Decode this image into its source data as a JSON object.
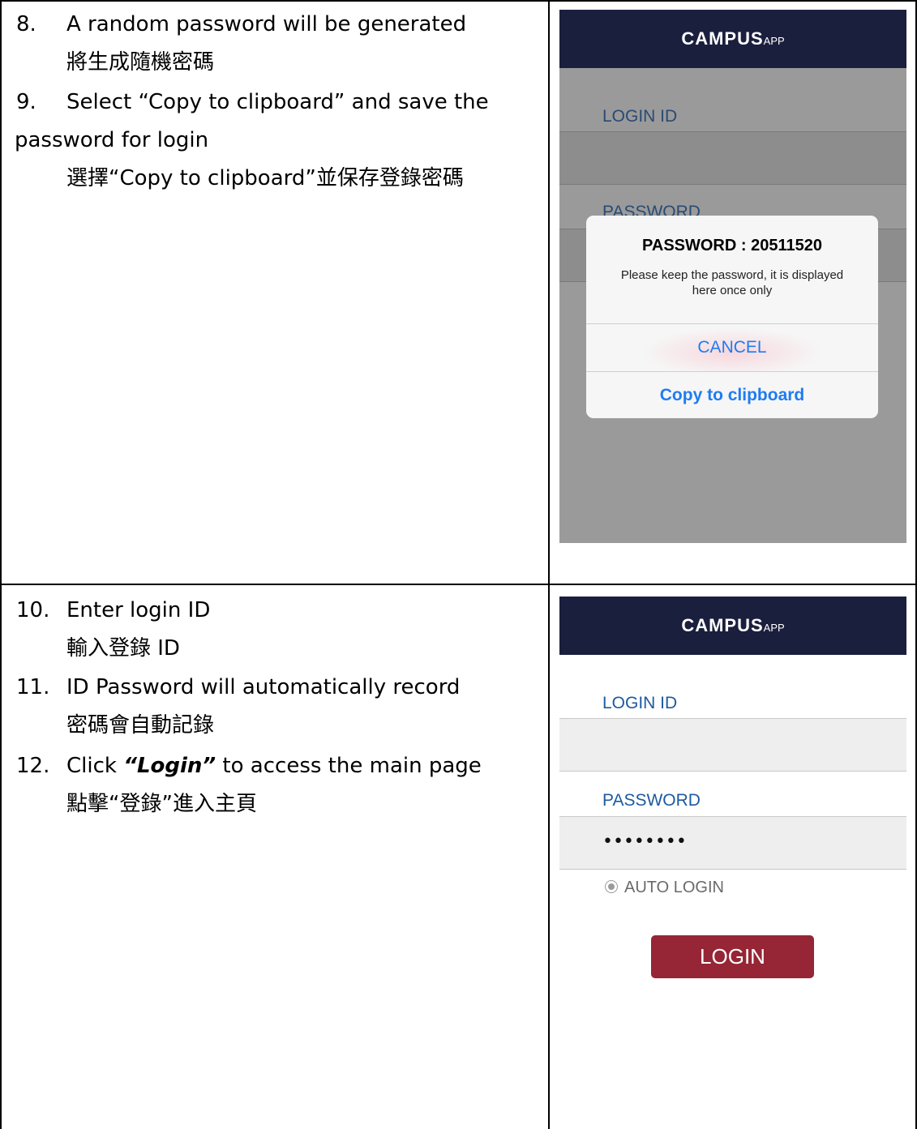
{
  "section1": {
    "steps": [
      {
        "num": "8.",
        "text": "A random password will be generated",
        "cjk": "將生成隨機密碼"
      },
      {
        "num": "9.",
        "text": "Select “Copy to clipboard” and save the",
        "cont": "password for login",
        "cjk": "選擇“Copy to clipboard”並保存登錄密碼"
      }
    ],
    "phone": {
      "brand": "CAMPUS",
      "brand_suffix": "APP",
      "login_id_label": "LOGIN ID",
      "password_label": "PASSWORD",
      "dialog": {
        "title": "PASSWORD : 20511520",
        "message": "Please keep the password, it is displayed here once only",
        "cancel_label": "CANCEL",
        "copy_label": "Copy to clipboard"
      }
    }
  },
  "section2": {
    "steps": [
      {
        "num": "10.",
        "text": "Enter login ID",
        "cjk": "輸入登錄  ID"
      },
      {
        "num": "11.",
        "text": "ID Password will automatically record",
        "cjk": "密碼會自動記錄"
      },
      {
        "num": "12.",
        "text_pre": "Click ",
        "text_em": "“Login”",
        "text_post": " to access the main page",
        "cjk": "點擊“登錄”進入主頁"
      }
    ],
    "phone": {
      "brand": "CAMPUS",
      "brand_suffix": "APP",
      "login_id_label": "LOGIN ID",
      "login_id_value": "",
      "password_label": "PASSWORD",
      "password_value": "••••••••",
      "auto_login_label": "AUTO LOGIN",
      "login_button_label": "LOGIN"
    }
  },
  "colors": {
    "header_bg": "#1b1f3e",
    "label_blue": "#1d5aa0",
    "login_button": "#962535",
    "dialog_button_blue": "#1e7cf2"
  }
}
